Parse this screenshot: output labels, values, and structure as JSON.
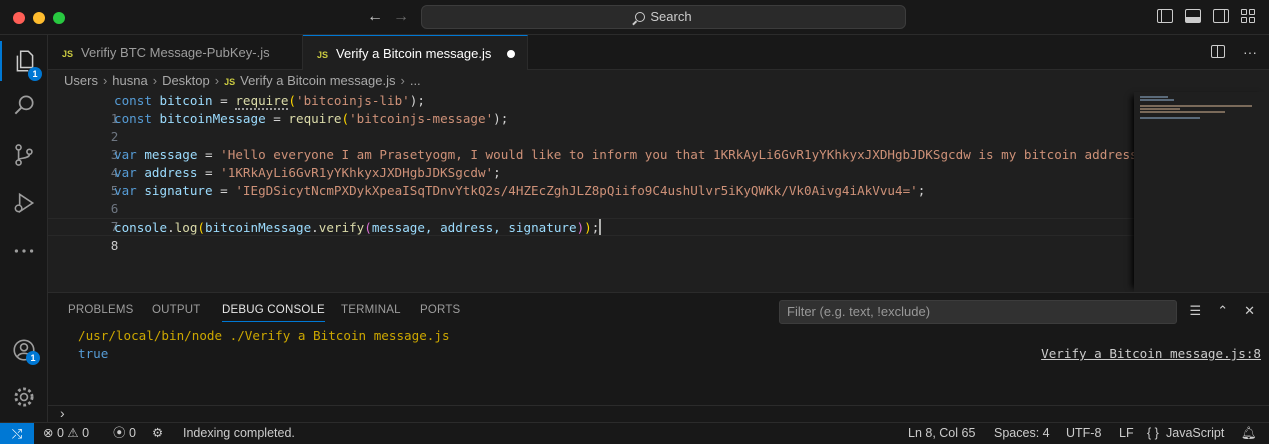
{
  "window": {
    "search_label": "Search",
    "nav_back": "←",
    "nav_forward": "→"
  },
  "activity_bar": {
    "explorer_badge": "1",
    "accounts_badge": "1"
  },
  "tabs": [
    {
      "icon": "JS",
      "label": "Verifiy BTC Message-PubKey-.js",
      "active": false
    },
    {
      "icon": "JS",
      "label": "Verify a Bitcoin message.js",
      "active": true,
      "modified": true
    }
  ],
  "breadcrumb": {
    "items": [
      "Users",
      "husna",
      "Desktop"
    ],
    "file_icon": "JS",
    "file": "Verify a Bitcoin message.js",
    "symbol": "...",
    "separator": "›"
  },
  "editor": {
    "line_numbers": [
      "1",
      "2",
      "3",
      "4",
      "5",
      "6",
      "7",
      "8"
    ],
    "current_line": "8",
    "lines": {
      "l1": {
        "kw": "const",
        "name": "bitcoin",
        "eq": " = ",
        "fn": "require",
        "open": "(",
        "arg": "'bitcoinjs-lib'",
        "close": ");"
      },
      "l2": {
        "kw": "const",
        "name": "bitcoinMessage",
        "eq": " = ",
        "fn": "require",
        "open": "(",
        "arg": "'bitcoinjs-message'",
        "close": ");"
      },
      "l4": {
        "kw": "var",
        "name": "message",
        "eq": " = ",
        "value": "'Hello everyone I am Prasetyogm, I would like to inform you that 1KRkAyLi6GvR1yYKhkyxJXDHgbJDKSgcdw is my bitcoin address.'",
        "end": ";"
      },
      "l5": {
        "kw": "var",
        "name": "address",
        "eq": " = ",
        "value": "'1KRkAyLi6GvR1yYKhkyxJXDHgbJDKSgcdw'",
        "end": ";"
      },
      "l6": {
        "kw": "var",
        "name": "signature",
        "eq": " = ",
        "value": "'IEgDSicytNcmPXDykXpeaISqTDnvYtkQ2s/4HZEcZghJLZ8pQiifo9C4ushUlvr5iKyQWKk/Vk0Aivg4iAkVvu4='",
        "end": ";"
      },
      "l8": {
        "obj": "console",
        "dot1": ".",
        "fn1": "log",
        "open1": "(",
        "obj2": "bitcoinMessage",
        "dot2": ".",
        "fn2": "verify",
        "open2": "(",
        "args": "message, address, signature",
        "close2": ")",
        "close1": ")",
        "end": ";"
      }
    }
  },
  "panel": {
    "tabs": [
      "PROBLEMS",
      "OUTPUT",
      "DEBUG CONSOLE",
      "TERMINAL",
      "PORTS"
    ],
    "active_tab": "DEBUG CONSOLE",
    "filter_placeholder": "Filter (e.g. text, !exclude)",
    "output": {
      "command": "/usr/local/bin/node ./Verify a Bitcoin message.js",
      "result": "true",
      "source": "Verify a Bitcoin message.js:8"
    },
    "repl_prompt": "›"
  },
  "statusbar": {
    "remote_icon": "⤭",
    "errors": "0",
    "warnings": "0",
    "ports": "0",
    "message": "Indexing completed.",
    "position": "Ln 8, Col 65",
    "spaces": "Spaces: 4",
    "encoding": "UTF-8",
    "eol": "LF",
    "braces": "{ }",
    "language": "JavaScript"
  },
  "colors": {
    "accent": "#0078d4",
    "keyword": "#569cd6",
    "string": "#ce9178",
    "function": "#dcdcaa",
    "variable": "#9cdcfe"
  }
}
